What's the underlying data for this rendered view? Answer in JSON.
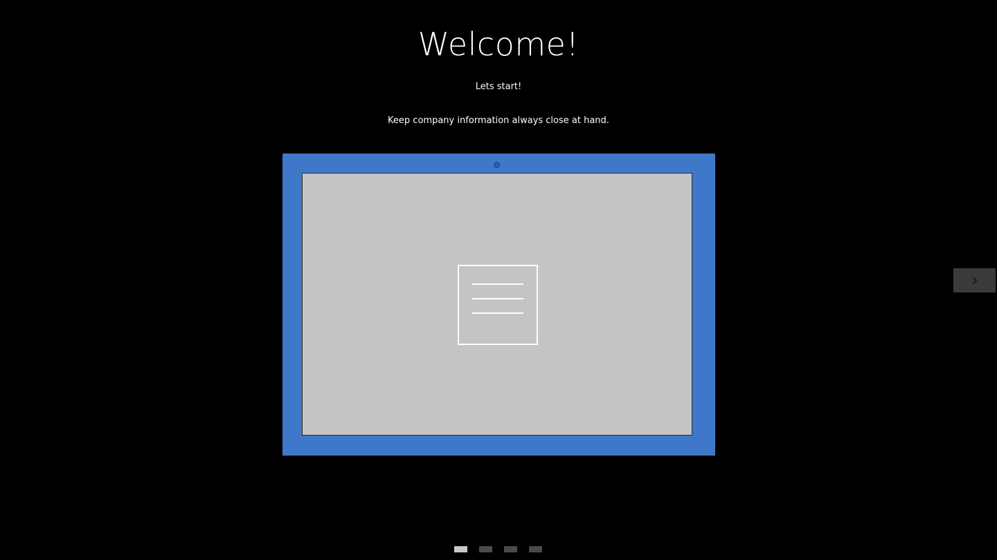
{
  "welcome": {
    "title": "Welcome!",
    "subtitle": "Lets start!",
    "tagline": "Keep company information always close at hand."
  },
  "illustration": {
    "device": "tablet",
    "icon": "document-lines-icon",
    "colors": {
      "bezel": "#3f78c8",
      "screen": "#c4c4c4",
      "camera": "#2e5fa8",
      "icon_stroke": "#ffffff"
    }
  },
  "navigation": {
    "next_icon": "chevron-right-icon",
    "next_button_bg": "#3a3a3a",
    "next_icon_color": "#1a1a1a"
  },
  "pager": {
    "pages": 4,
    "current": 1,
    "active_color": "#c8c8c8",
    "inactive_color": "#4a4a4a"
  }
}
